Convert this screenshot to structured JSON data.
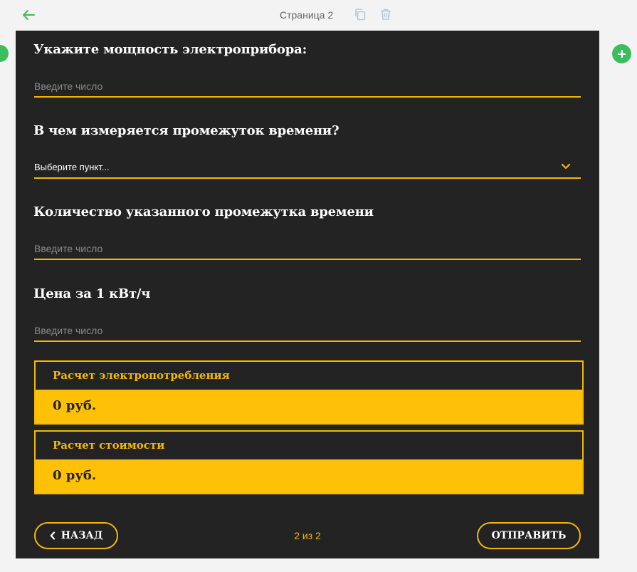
{
  "header": {
    "page_title": "Страница 2"
  },
  "form": {
    "power": {
      "label": "Укажите мощность электроприбора:",
      "placeholder": "Введите число",
      "value": ""
    },
    "time_unit": {
      "label": "В чем измеряется промежуток времени?",
      "selected": "Выберите пункт..."
    },
    "time_amount": {
      "label": "Количество указанного промежутка времени",
      "placeholder": "Введите число",
      "value": ""
    },
    "price": {
      "label": "Цена за 1 кВт/ч",
      "placeholder": "Введите число",
      "value": ""
    }
  },
  "results": {
    "consumption": {
      "title": "Расчет электропотребления",
      "value": "0 руб."
    },
    "cost": {
      "title": "Расчет стоимости",
      "value": "0 руб."
    }
  },
  "footer": {
    "back_label": "НАЗАД",
    "pager": "2 из 2",
    "submit_label": "ОТПРАВИТЬ"
  },
  "colors": {
    "accent": "#f5b800",
    "panel": "#232323",
    "add_button": "#3dbd5d"
  },
  "icons": [
    "back-arrow-icon",
    "copy-icon",
    "trash-icon",
    "plus-icon",
    "chevron-down-icon",
    "chevron-left-icon"
  ]
}
